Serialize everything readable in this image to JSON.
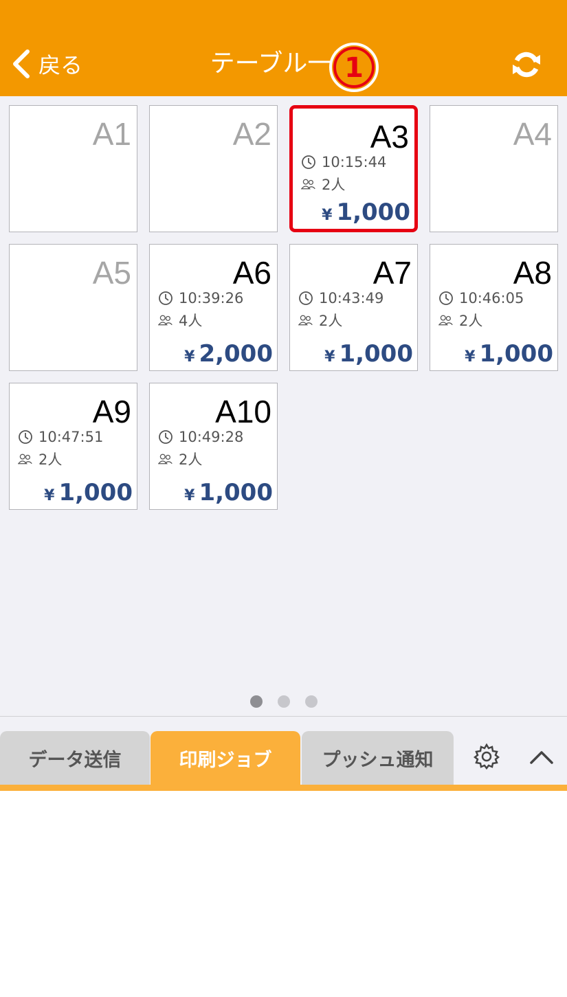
{
  "header": {
    "back_label": "戻る",
    "title": "テーブル一覧",
    "step_marker": "1",
    "bg_color": "#f39800"
  },
  "tables": [
    {
      "name": "A1",
      "occupied": false
    },
    {
      "name": "A2",
      "occupied": false
    },
    {
      "name": "A3",
      "occupied": true,
      "time": "10:15:44",
      "people": "2人",
      "currency": "¥",
      "price": "1,000",
      "selected": true
    },
    {
      "name": "A4",
      "occupied": false
    },
    {
      "name": "A5",
      "occupied": false
    },
    {
      "name": "A6",
      "occupied": true,
      "time": "10:39:26",
      "people": "4人",
      "currency": "¥",
      "price": "2,000"
    },
    {
      "name": "A7",
      "occupied": true,
      "time": "10:43:49",
      "people": "2人",
      "currency": "¥",
      "price": "1,000"
    },
    {
      "name": "A8",
      "occupied": true,
      "time": "10:46:05",
      "people": "2人",
      "currency": "¥",
      "price": "1,000"
    },
    {
      "name": "A9",
      "occupied": true,
      "time": "10:47:51",
      "people": "2人",
      "currency": "¥",
      "price": "1,000"
    },
    {
      "name": "A10",
      "occupied": true,
      "time": "10:49:28",
      "people": "2人",
      "currency": "¥",
      "price": "1,000"
    }
  ],
  "pagination": {
    "pages": 3,
    "current": 1
  },
  "tabbar": {
    "tabs": [
      {
        "label": "データ送信",
        "active": false
      },
      {
        "label": "印刷ジョブ",
        "active": true
      },
      {
        "label": "プッシュ通知",
        "active": false
      }
    ],
    "icons": [
      "gear-icon",
      "chevron-up-icon"
    ]
  },
  "colors": {
    "accent": "#f39800",
    "tab_active": "#fbb03b",
    "price": "#2d4b82",
    "selected_border": "#e60012"
  }
}
